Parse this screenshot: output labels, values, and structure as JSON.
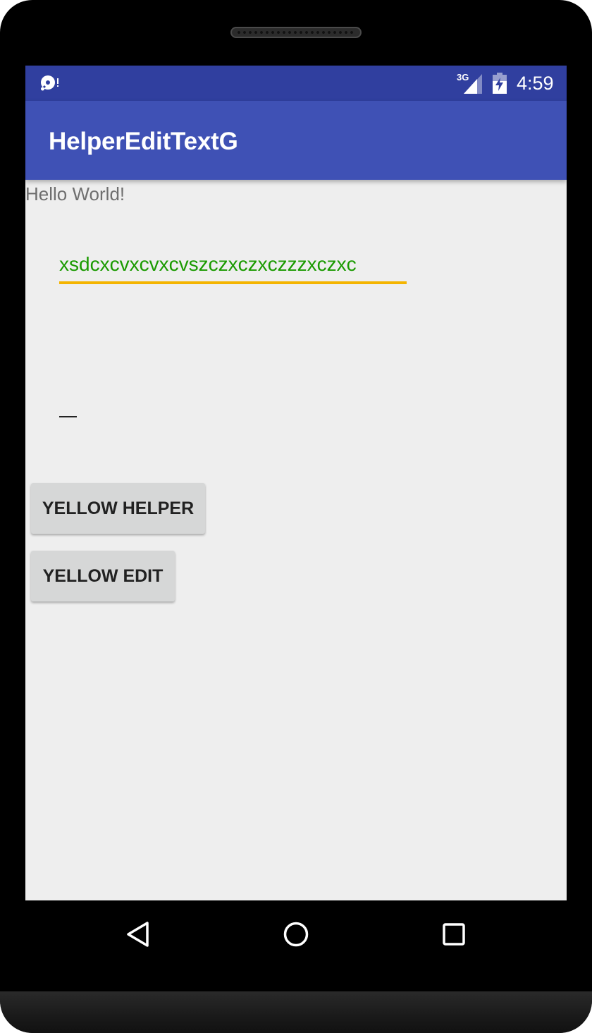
{
  "status_bar": {
    "network": "3G",
    "time": "4:59",
    "icons": [
      "sd-card-warning-icon",
      "signal-icon",
      "battery-charging-icon"
    ]
  },
  "app_bar": {
    "title": "HelperEditTextG"
  },
  "content": {
    "hello_text": "Hello World!",
    "edit_text_value": "xsdcxcvxcvxcvszczxczxczzzxczxc",
    "empty_edit_text_value": "",
    "buttons": {
      "yellow_helper": "YELLOW HELPER",
      "yellow_edit": "YELLOW EDIT"
    }
  },
  "colors": {
    "status_bar": "#303f9f",
    "app_bar": "#3f51b5",
    "edit_text": "#1a9a00",
    "underline": "#f4b400",
    "background": "#eeeeee"
  },
  "nav_bar": {
    "icons": [
      "back-icon",
      "home-icon",
      "recents-icon"
    ]
  }
}
